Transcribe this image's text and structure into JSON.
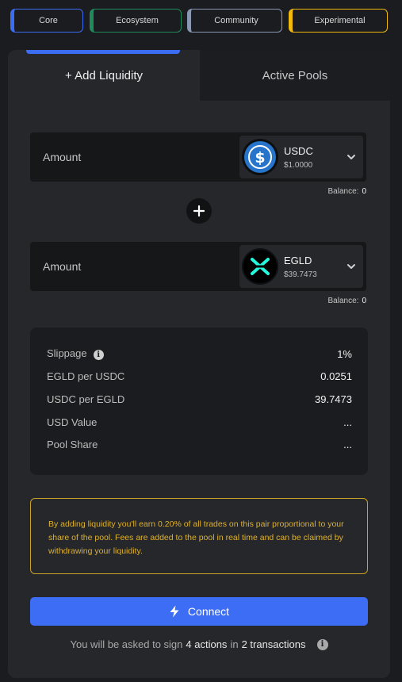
{
  "categories": [
    {
      "label": "Core",
      "color": "#3c6cf0"
    },
    {
      "label": "Ecosystem",
      "color": "#1f8a5a"
    },
    {
      "label": "Community",
      "color": "#8a98b5"
    },
    {
      "label": "Experimental",
      "color": "#f0b90b"
    }
  ],
  "tabs": {
    "add_liquidity": "+ Add Liquidity",
    "active_pools": "Active Pools"
  },
  "inputs": [
    {
      "label": "Amount",
      "token_symbol": "USDC",
      "token_price": "$1.0000",
      "balance_label": "Balance:",
      "balance_value": "0",
      "icon": "usdc-icon"
    },
    {
      "label": "Amount",
      "token_symbol": "EGLD",
      "token_price": "$39.7473",
      "balance_label": "Balance:",
      "balance_value": "0",
      "icon": "egld-icon"
    }
  ],
  "info": {
    "slippage_label": "Slippage",
    "slippage_value": "1%",
    "egld_per_usdc_label": "EGLD per USDC",
    "egld_per_usdc_value": "0.0251",
    "usdc_per_egld_label": "USDC per EGLD",
    "usdc_per_egld_value": "39.7473",
    "usd_value_label": "USD Value",
    "usd_value_value": "...",
    "pool_share_label": "Pool Share",
    "pool_share_value": "..."
  },
  "warning": {
    "line1": "By adding liquidity you'll earn 0.20% of all trades on this pair proportional to your",
    "line2": "share of the pool. Fees are added to the pool in real time and can be claimed by",
    "line3": "withdrawing your liquidity."
  },
  "connect_label": "Connect",
  "note": {
    "prefix": "You will be asked to sign",
    "actions": "4 actions",
    "middle": "in",
    "transactions": "2 transactions"
  },
  "colors": {
    "accent": "#3d6cf5",
    "warning": "#e0b12a",
    "usdc": "#2775ca",
    "egld": "#23f7dd"
  }
}
